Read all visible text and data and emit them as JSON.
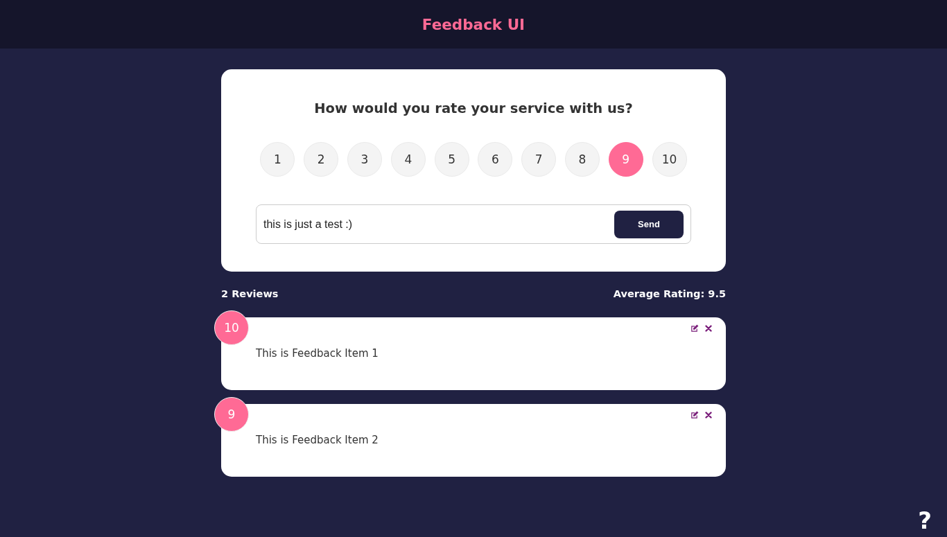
{
  "header": {
    "title": "Feedback UI"
  },
  "rating_form": {
    "question": "How would you rate your service with us?",
    "options": [
      {
        "label": "1",
        "selected": false
      },
      {
        "label": "2",
        "selected": false
      },
      {
        "label": "3",
        "selected": false
      },
      {
        "label": "4",
        "selected": false
      },
      {
        "label": "5",
        "selected": false
      },
      {
        "label": "6",
        "selected": false
      },
      {
        "label": "7",
        "selected": false
      },
      {
        "label": "8",
        "selected": false
      },
      {
        "label": "9",
        "selected": true
      },
      {
        "label": "10",
        "selected": false
      }
    ],
    "review_field": {
      "value": "this is just a test :)"
    },
    "send_button": "Send"
  },
  "stats": {
    "count": "2 Reviews",
    "average": "Average Rating: 9.5"
  },
  "reviews": [
    {
      "rating": "10",
      "text": "This is Feedback Item 1"
    },
    {
      "rating": "9",
      "text": "This is Feedback Item 2"
    }
  ],
  "help_link": "?"
}
